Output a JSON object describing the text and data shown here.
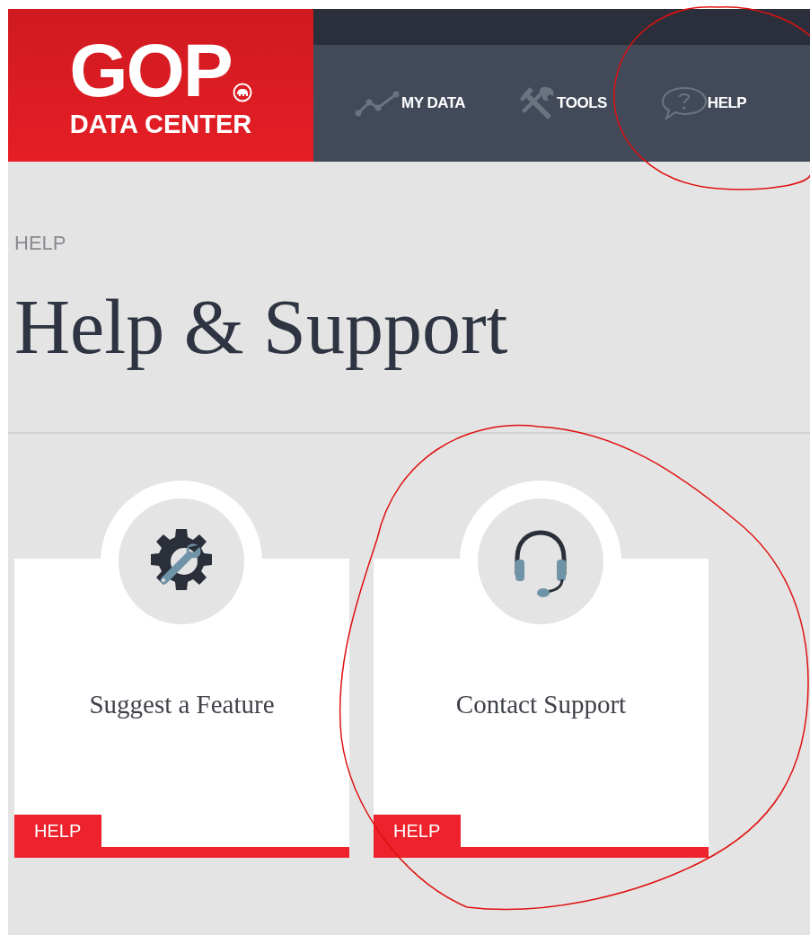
{
  "logo": {
    "title": "GOP",
    "subtitle": "DATA CENTER"
  },
  "nav": [
    {
      "kind": "chart",
      "label": "MY DATA"
    },
    {
      "kind": "tools",
      "label": "TOOLS"
    },
    {
      "kind": "help",
      "label": "HELP"
    }
  ],
  "breadcrumb": "HELP",
  "heading": "Help & Support",
  "cards": [
    {
      "kind": "feature",
      "title": "Suggest a Feature",
      "tag": "HELP"
    },
    {
      "kind": "support",
      "title": "Contact Support",
      "tag": "HELP"
    }
  ]
}
